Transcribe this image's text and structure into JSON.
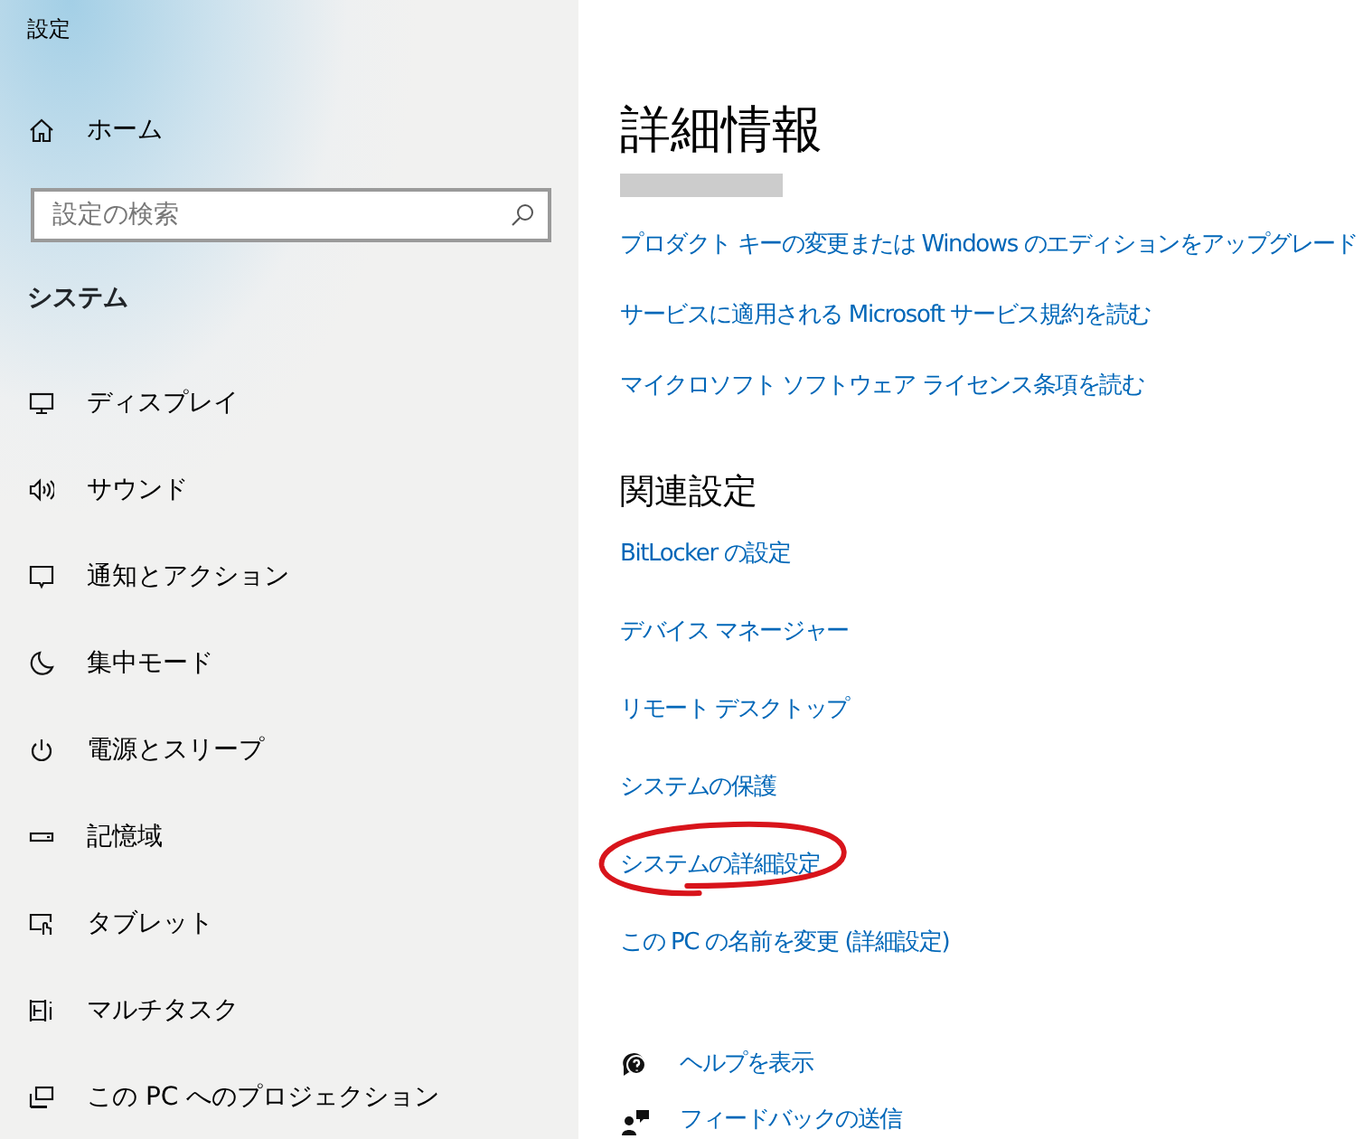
{
  "window": {
    "title": "設定"
  },
  "sidebar": {
    "home": "ホーム",
    "search": {
      "placeholder": "設定の検索"
    },
    "section": "システム",
    "items": [
      {
        "label": "ディスプレイ"
      },
      {
        "label": "サウンド"
      },
      {
        "label": "通知とアクション"
      },
      {
        "label": "集中モード"
      },
      {
        "label": "電源とスリープ"
      },
      {
        "label": "記憶域"
      },
      {
        "label": "タブレット"
      },
      {
        "label": "マルチタスク"
      },
      {
        "label": "この PC へのプロジェクション"
      }
    ]
  },
  "content": {
    "title": "詳細情報",
    "links": [
      {
        "label": "プロダクト キーの変更または Windows のエディションをアップグレード"
      },
      {
        "label": "サービスに適用される Microsoft サービス規約を読む"
      },
      {
        "label": "マイクロソフト ソフトウェア ライセンス条項を読む"
      }
    ],
    "related": {
      "title": "関連設定",
      "links": [
        {
          "label": "BitLocker の設定",
          "circled": false
        },
        {
          "label": "デバイス マネージャー",
          "circled": false
        },
        {
          "label": "リモート デスクトップ",
          "circled": false
        },
        {
          "label": "システムの保護",
          "circled": false
        },
        {
          "label": "システムの詳細設定",
          "circled": true
        },
        {
          "label": "この PC の名前を変更 (詳細設定)",
          "circled": false
        }
      ]
    },
    "help": [
      {
        "label": "ヘルプを表示"
      },
      {
        "label": "フィードバックの送信"
      }
    ]
  }
}
